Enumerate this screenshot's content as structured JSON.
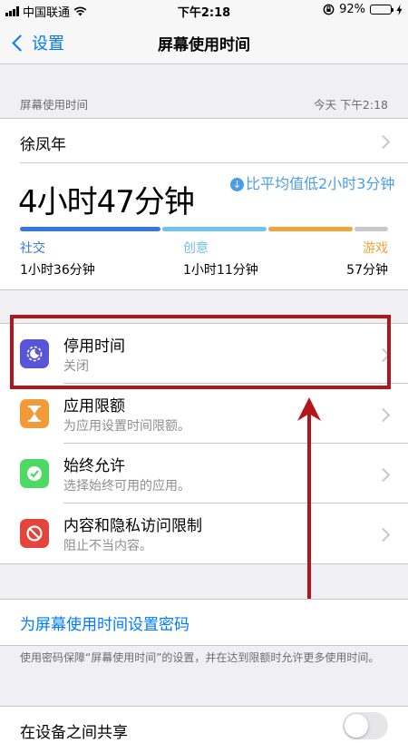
{
  "status_bar": {
    "carrier": "中国联通",
    "time": "下午2:18",
    "battery_percent": "92%",
    "battery_level": 0.92
  },
  "nav": {
    "back_label": "设置",
    "title": "屏幕使用时间"
  },
  "summary": {
    "section_title": "屏幕使用时间",
    "date": "今天 下午2:18",
    "user_name": "徐凤年",
    "total_time": "4小时47分钟",
    "comparison": "比平均值低2小时3分钟",
    "categories": [
      {
        "name": "社交",
        "time": "1小时36分钟",
        "minutes": 96,
        "color": "#3478e0"
      },
      {
        "name": "创意",
        "time": "1小时11分钟",
        "minutes": 71,
        "color": "#6fc3f0"
      },
      {
        "name": "游戏",
        "time": "57分钟",
        "minutes": 57,
        "color": "#f2a33a"
      }
    ],
    "other_minutes": 23,
    "other_color": "#c7c7cc"
  },
  "items": [
    {
      "title": "停用时间",
      "subtitle": "关闭",
      "icon": "moon-icon",
      "color": "#5856d6"
    },
    {
      "title": "应用限额",
      "subtitle": "为应用设置时间限额。",
      "icon": "hourglass-icon",
      "color": "#f19a37"
    },
    {
      "title": "始终允许",
      "subtitle": "选择始终可用的应用。",
      "icon": "check-badge-icon",
      "color": "#4cd964"
    },
    {
      "title": "内容和隐私访问限制",
      "subtitle": "阻止不当内容。",
      "icon": "no-entry-icon",
      "color": "#e5443b"
    }
  ],
  "passcode": {
    "link": "为屏幕使用时间设置密码",
    "footnote": "使用密码保障“屏幕使用时间”的设置，并在达到限额时允许更多使用时间。"
  },
  "share": {
    "label": "在设备之间共享",
    "enabled": false
  },
  "annotation": {
    "highlight_color": "#b3161a"
  }
}
